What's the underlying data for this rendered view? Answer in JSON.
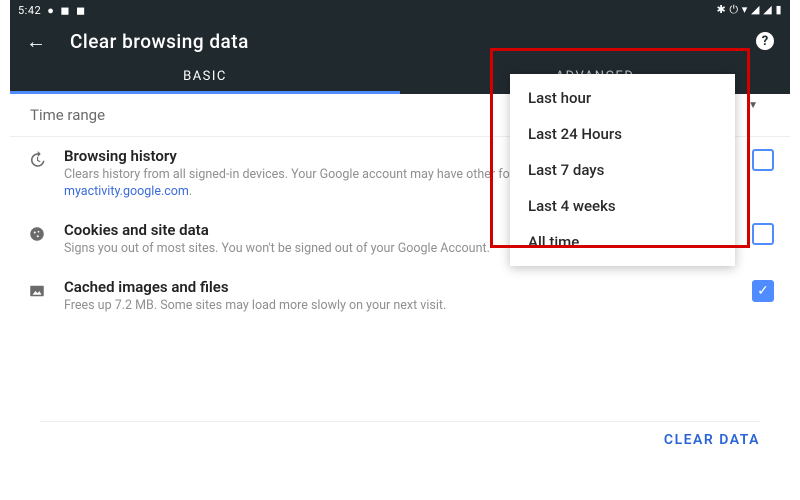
{
  "status": {
    "time": "5:42",
    "icons_right": "✱  ⏻  ▾  ◢  ◢  ▮"
  },
  "appbar": {
    "title": "Clear browsing data"
  },
  "tabs": {
    "basic": "BASIC",
    "advanced": "ADVANCED"
  },
  "time_range": {
    "label": "Time range"
  },
  "dropdown": {
    "opts": [
      "Last hour",
      "Last 24 Hours",
      "Last 7 days",
      "Last 4 weeks",
      "All time"
    ]
  },
  "items": [
    {
      "title": "Browsing history",
      "sub_before": "Clears history from all signed-in devices. Your Google account may have other forms of browsing history at ",
      "link": "myactivity.google.com",
      "sub_after": ".",
      "checked": false
    },
    {
      "title": "Cookies and site data",
      "sub_before": "Signs you out of most sites. You won't be signed out of your Google Account.",
      "link": "",
      "sub_after": "",
      "checked": false
    },
    {
      "title": "Cached images and files",
      "sub_before": "Frees up 7.2 MB. Some sites may load more slowly on your next visit.",
      "link": "",
      "sub_after": "",
      "checked": true
    }
  ],
  "footer": {
    "clear": "CLEAR DATA"
  }
}
